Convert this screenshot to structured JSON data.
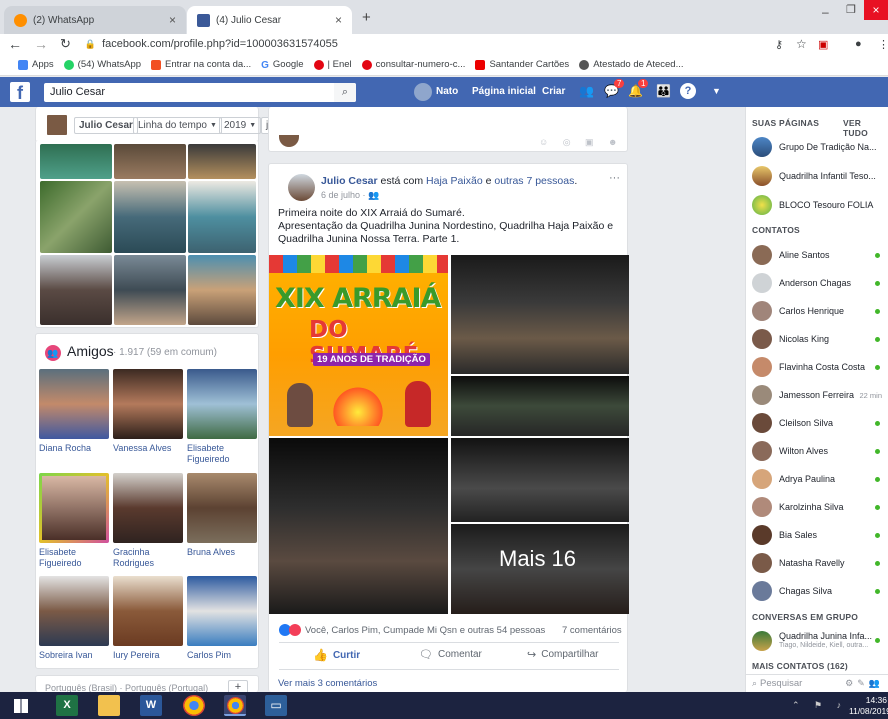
{
  "browser": {
    "tabs": [
      {
        "label": "(2) WhatsApp",
        "icon": "whatsapp-icon"
      },
      {
        "label": "(4) Julio Cesar",
        "icon": "facebook-icon"
      }
    ],
    "url": "facebook.com/profile.php?id=100003631574055",
    "bookmarks": [
      "Apps",
      "(54) WhatsApp",
      "Entrar na conta da...",
      "Google",
      "| Enel",
      "consultar-numero-c...",
      "Santander Cartões",
      "Atestado de Ateced..."
    ]
  },
  "fb": {
    "search_value": "Julio Cesar",
    "user": "Nato",
    "home": "Página inicial",
    "create": "Criar",
    "badges": [
      "7",
      "1"
    ]
  },
  "profile_nav": {
    "name": "Julio Cesar",
    "timeline": "Linha do tempo",
    "year": "2019",
    "month": "julho"
  },
  "friends": {
    "title": "Amigos",
    "count": "· 1.917 (59 em comum)",
    "items": [
      {
        "name": "Diana Rocha"
      },
      {
        "name": "Vanessa Alves"
      },
      {
        "name": "Elisabete Figueiredo"
      },
      {
        "name": "Elisabete Figueiredo"
      },
      {
        "name": "Gracinha Rodrigues"
      },
      {
        "name": "Bruna Alves"
      },
      {
        "name": "Sobreira Ivan"
      },
      {
        "name": "Iury Pereira"
      },
      {
        "name": "Carlos Pim"
      }
    ]
  },
  "languages": "Português (Brasil) · Português (Portugal)",
  "post": {
    "author": "Julio Cesar",
    "with_text": " está com ",
    "tag1": "Haja Paixão",
    "and_text": " e ",
    "tag2": "outras 7 pessoas",
    "date": "6 de julho",
    "text_line1": "Primeira noite do XIX Arraiá do Sumaré.",
    "text_line2": "Apresentação da Quadrilha Junina Nordestino, Quadrilha Haja Paixão e",
    "text_line3": "Quadrilha Junina Nossa Terra. Parte 1.",
    "poster_line1": "XIX ARRAIÁ",
    "poster_line2": "DO SUMARÉ",
    "poster_line3": "19 ANOS DE TRADIÇÃO",
    "more_photos": "Mais 16",
    "reactions": "Você, Carlos Pim, Cumpade Mi Qsn e outras 54 pessoas",
    "comments_count": "7 comentários",
    "like": "Curtir",
    "comment": "Comentar",
    "share": "Compartilhar",
    "more_comments": "Ver mais 3 comentários"
  },
  "sidebar": {
    "pages_title": "SUAS PÁGINAS",
    "see_all": "VER TUDO",
    "pages": [
      "Grupo De Tradição Na...",
      "Quadrilha Infantil Teso...",
      "BLOCO Tesouro FOLIA"
    ],
    "contacts_title": "CONTATOS",
    "contacts": [
      {
        "name": "Aline Santos",
        "status": "online"
      },
      {
        "name": "Anderson Chagas",
        "status": "online"
      },
      {
        "name": "Carlos Henrique",
        "status": "online"
      },
      {
        "name": "Nicolas King",
        "status": "online"
      },
      {
        "name": "Flavinha Costa Costa",
        "status": "online"
      },
      {
        "name": "Jamesson Ferreira",
        "status": "22 min"
      },
      {
        "name": "Cleilson Silva",
        "status": "online"
      },
      {
        "name": "Wilton Alves",
        "status": "online"
      },
      {
        "name": "Adrya Paulina",
        "status": "online"
      },
      {
        "name": "Karolzinha Silva",
        "status": "online"
      },
      {
        "name": "Bia Sales",
        "status": "online"
      },
      {
        "name": "Natasha Ravelly",
        "status": "online"
      },
      {
        "name": "Chagas Silva",
        "status": "online"
      }
    ],
    "groups_title": "CONVERSAS EM GRUPO",
    "group_name": "Quadrilha Junina Infa...",
    "group_members": "Tiago, Nildeide, Kiell, outra...",
    "more_contacts": "MAIS CONTATOS (162)",
    "search_placeholder": "Pesquisar"
  },
  "taskbar": {
    "time": "14:36",
    "date": "11/08/2019"
  },
  "colors": {
    "fb_blue": "#4267b2",
    "link": "#385898",
    "online": "#42b72a"
  }
}
